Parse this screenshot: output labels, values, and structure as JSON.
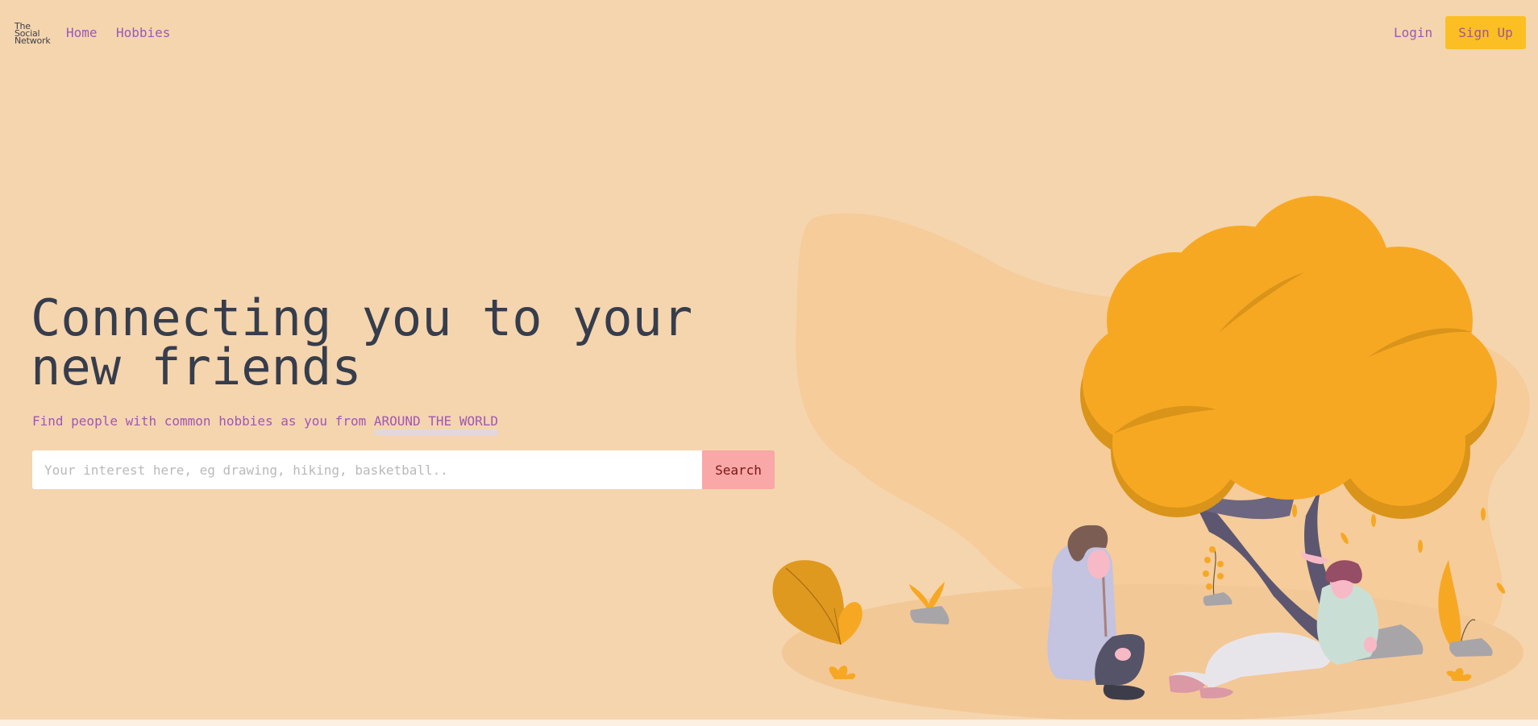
{
  "nav": {
    "logo_lines": [
      "The",
      "Social",
      "Network"
    ],
    "home": "Home",
    "hobbies": "Hobbies",
    "login": "Login",
    "signup": "Sign Up"
  },
  "hero": {
    "title_line1": "Connecting you to your",
    "title_line2": "new friends",
    "subtitle_prefix": "Find people with common hobbies as you from",
    "subtitle_highlight": "AROUND THE WORLD",
    "search_placeholder": "Your interest here, eg drawing, hiking, basketball..",
    "search_value": "",
    "search_button": "Search"
  },
  "illustration": {
    "icon": "two-people-under-tree-illustration",
    "colors": {
      "tree_foliage": "#f7a823",
      "tree_trunk": "#5d5670",
      "blob": "#f5cc9a",
      "ground": "#f3c897"
    }
  },
  "colors": {
    "background": "#f5d5ae",
    "link": "#9b59b6",
    "signup_bg": "#fbbf24",
    "search_button_bg": "#f9a7a7",
    "title": "#363d4c"
  }
}
